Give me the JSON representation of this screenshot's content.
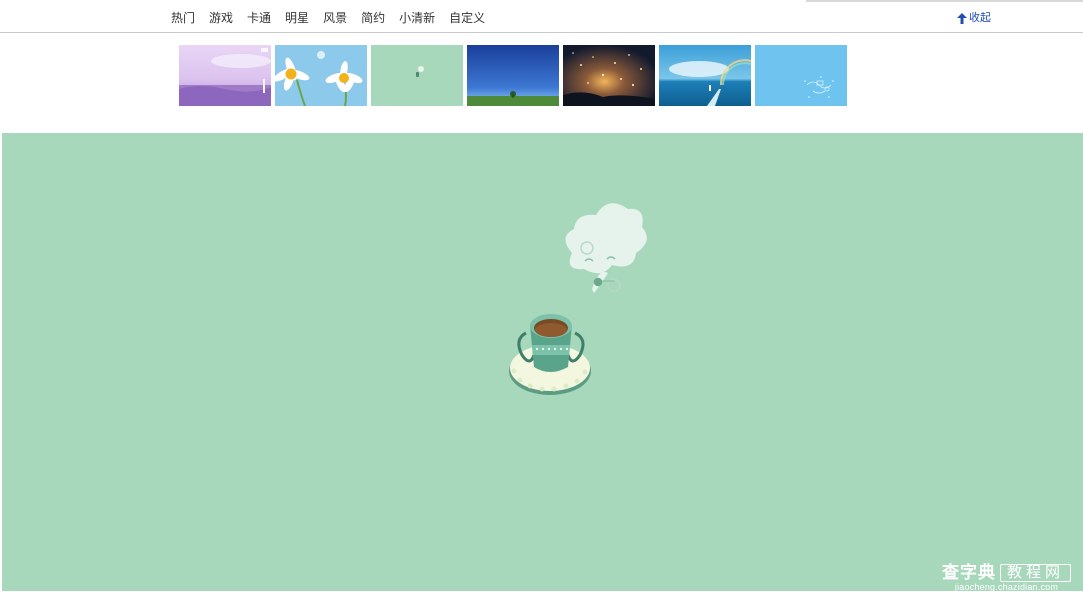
{
  "nav": {
    "items": [
      {
        "label": "热门"
      },
      {
        "label": "游戏"
      },
      {
        "label": "卡通"
      },
      {
        "label": "明星"
      },
      {
        "label": "风景"
      },
      {
        "label": "简约"
      },
      {
        "label": "小清新"
      },
      {
        "label": "自定义"
      }
    ],
    "collapse_label": "收起"
  },
  "thumbnails": [
    {
      "name": "lavender-field"
    },
    {
      "name": "daisies"
    },
    {
      "name": "mint-dandelion"
    },
    {
      "name": "blue-sky-field"
    },
    {
      "name": "night-sky-lanterns"
    },
    {
      "name": "ocean-rainbow"
    },
    {
      "name": "light-blue-doodle"
    }
  ],
  "preview": {
    "background": "#a8d8bc"
  },
  "watermark": {
    "brand": "查字典",
    "boxed": "教程网",
    "url": "jiaocheng.chazidian.com"
  },
  "colors": {
    "accent": "#1f4fb0",
    "preview_bg": "#a8d8bc"
  }
}
